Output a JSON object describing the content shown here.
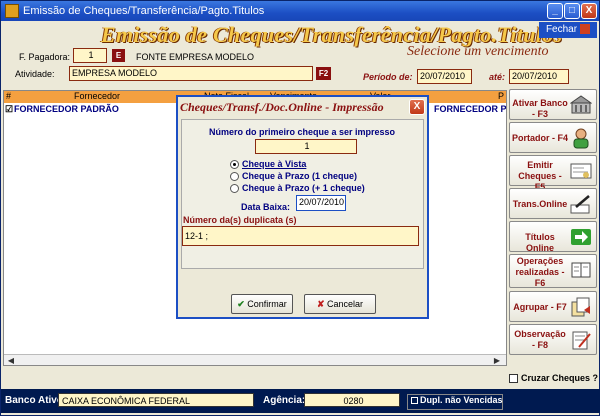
{
  "window": {
    "title": "Emissão de Cheques/Transferência/Pagto.Titulos",
    "minimize": "_",
    "maximize": "□",
    "close": "X"
  },
  "header": {
    "title": "Emissão de Cheques/Transferência/Pagto.Titulos",
    "subtitle": "Selecione um vencimento",
    "fechar": "Fechar"
  },
  "form": {
    "f_pagadora_label": "F. Pagadora:",
    "f_pagadora_value": "1",
    "f_pagadora_btn": "E",
    "empresa_name": "FONTE EMPRESA MODELO",
    "atividade_label": "Atividade:",
    "atividade_value": "EMPRESA MODELO",
    "atividade_btn": "F2",
    "periodo_label": "Período de:",
    "periodo_de": "20/07/2010",
    "ate_label": "até:",
    "periodo_ate": "20/07/2010"
  },
  "grid": {
    "headers": [
      "#",
      "Fornecedor",
      "Nota Fiscal",
      "Vencimento",
      "Valor",
      "P"
    ],
    "row": {
      "check": "☑",
      "fornecedor": "FORNECEDOR PADRÃO",
      "right": "FORNECEDOR PAD"
    }
  },
  "sidebar": {
    "buttons": [
      {
        "label": "Ativar Banco - F3",
        "icon": "bank-icon"
      },
      {
        "label": "Portador - F4",
        "icon": "person-icon"
      },
      {
        "label": "Emitir Cheques - F5",
        "icon": "cheque-icon"
      },
      {
        "label": "Trans.Online",
        "icon": "pen-icon"
      },
      {
        "label": "Títulos Online",
        "icon": "arrow-right-icon"
      },
      {
        "label": "Operações realizadas - F6",
        "icon": "book-icon"
      },
      {
        "label": "Agrupar - F7",
        "icon": "group-icon"
      },
      {
        "label": "Observação - F8",
        "icon": "notes-icon"
      }
    ],
    "cruzar": "Cruzar Cheques ?"
  },
  "footer": {
    "banco_label": "Banco Ativo:",
    "banco_value": "CAIXA ECONÔMICA FEDERAL",
    "agencia_label": "Agência:",
    "agencia_value": "0280",
    "dupl_label": "Dupl. não Vencidas"
  },
  "dialog": {
    "title": "Cheques/Transf./Doc.Online - Impressão",
    "close": "X",
    "first_cheque_label": "Número do primeiro cheque a ser impresso",
    "first_cheque_value": "1",
    "radio_options": [
      "Cheque à Vista",
      "Cheque à Prazo (1 cheque)",
      "Cheque à Prazo (+ 1 cheque)"
    ],
    "selected_option": "Cheque à Vista",
    "data_baixa_label": "Data Baixa:",
    "data_baixa_value": "20/07/2010",
    "duplicata_label": "Número da(s) duplicata (s)",
    "duplicata_value": "12-1 ;",
    "confirm": "Confirmar",
    "cancel": "Cancelar"
  }
}
